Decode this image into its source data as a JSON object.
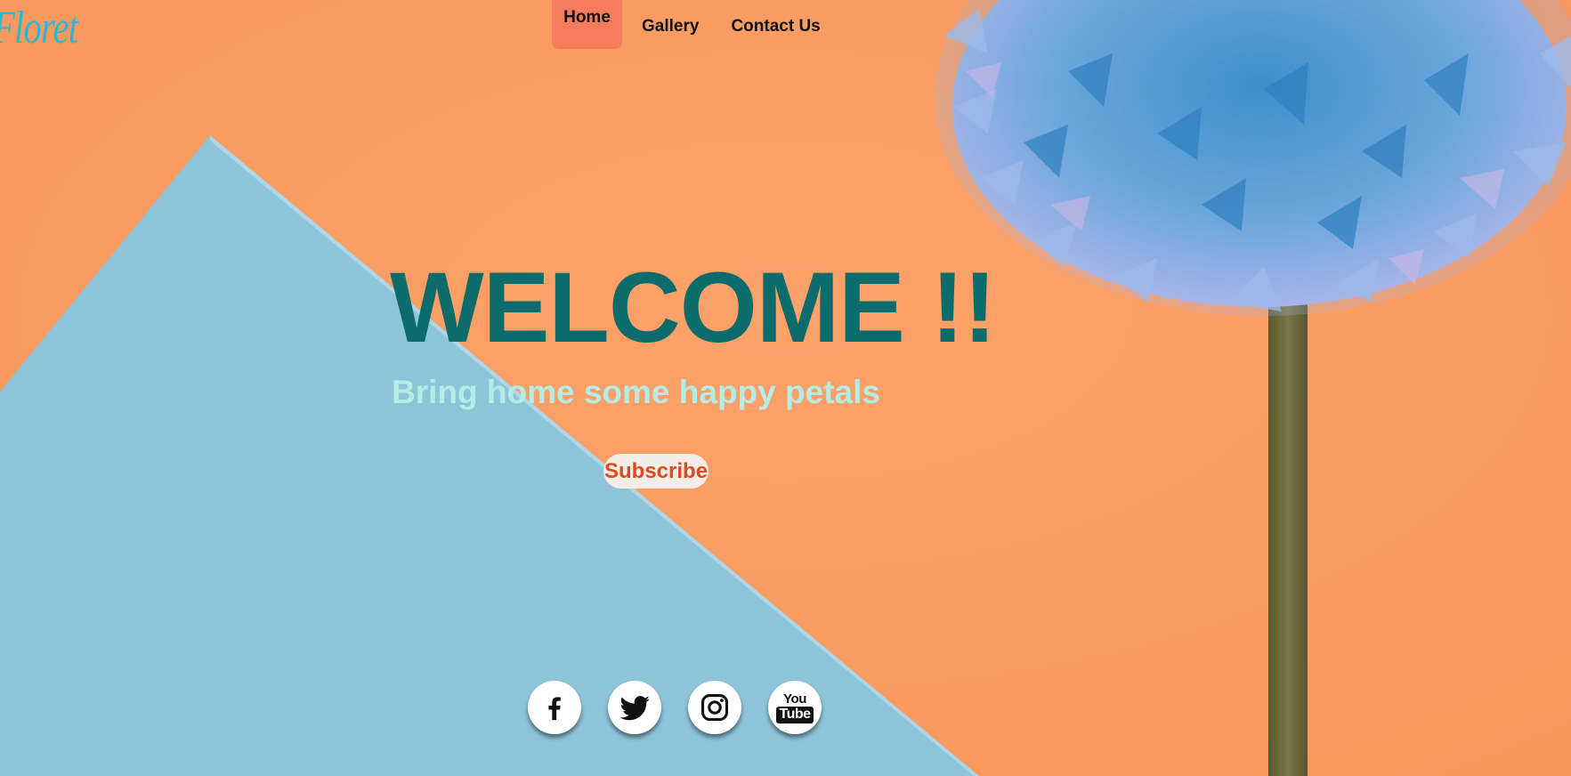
{
  "brand": {
    "logo_text": "Floret",
    "logo_color": "#2bb7d6"
  },
  "nav": {
    "items": [
      {
        "label": "Home",
        "active": true
      },
      {
        "label": "Gallery",
        "active": false
      },
      {
        "label": "Contact Us",
        "active": false
      }
    ],
    "active_color": "#f77c5c"
  },
  "hero": {
    "title": "WELCOME !!",
    "subtitle": "Bring home some happy petals",
    "title_color": "#0c6b6b",
    "subtitle_color": "#b4ece6"
  },
  "cta": {
    "subscribe_label": "Subscribe",
    "color": "#e14a1f"
  },
  "social": [
    {
      "icon": "facebook-icon"
    },
    {
      "icon": "twitter-icon"
    },
    {
      "icon": "instagram-icon"
    },
    {
      "icon": "youtube-icon",
      "text_top": "You",
      "text_bottom": "Tube"
    }
  ],
  "colors": {
    "background_orange": "#fb9d62",
    "background_blue": "#8ec5d8",
    "flower_blue": "#6fa3d8",
    "stem": "#6d6a3a"
  }
}
